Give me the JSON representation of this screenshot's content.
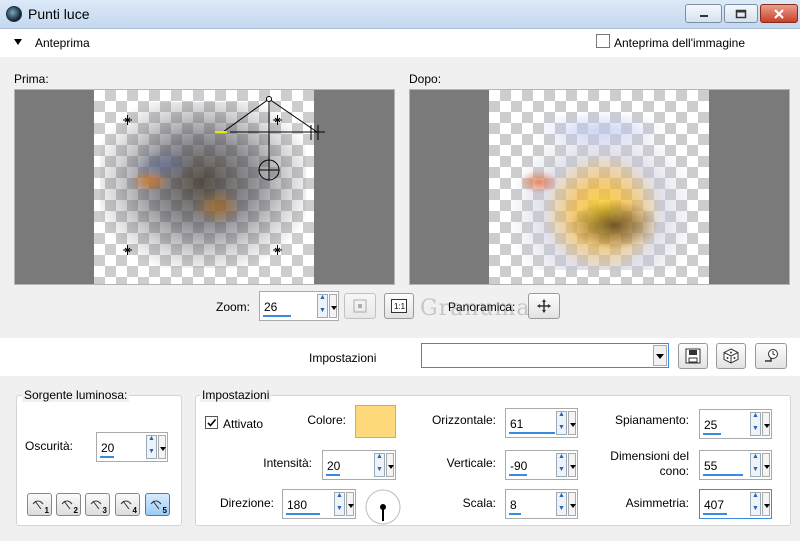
{
  "window": {
    "title": "Punti luce"
  },
  "preview_section": {
    "header_label": "Anteprima",
    "show_image_preview_label": "Anteprima dell'immagine",
    "show_image_preview_checked": false,
    "before_label": "Prima:",
    "after_label": "Dopo:",
    "zoom_label": "Zoom:",
    "zoom_value": "26",
    "pan_label": "Panoramica:"
  },
  "watermark": {
    "text": "Granuma"
  },
  "presets_bar": {
    "label": "Impostazioni",
    "value": ""
  },
  "light_source": {
    "title": "Sorgente luminosa:",
    "darkness_label": "Oscurità:",
    "darkness_value": "20",
    "presets": [
      "1",
      "2",
      "3",
      "4",
      "5"
    ],
    "selected_preset": "5"
  },
  "settings": {
    "title": "Impostazioni",
    "enabled_label": "Attivato",
    "enabled_checked": true,
    "color_label": "Colore:",
    "color_value": "#fdd97c",
    "intensity_label": "Intensità:",
    "intensity_value": "20",
    "direction_label": "Direzione:",
    "direction_value": "180",
    "horizontal_label": "Orizzontale:",
    "horizontal_value": "61",
    "vertical_label": "Verticale:",
    "vertical_value": "-90",
    "scale_label": "Scala:",
    "scale_value": "8",
    "flattening_label": "Spianamento:",
    "flattening_value": "25",
    "cone_size_label_1": "Dimensioni del",
    "cone_size_label_2": "cono:",
    "cone_size_value": "55",
    "asymmetry_label": "Asimmetria:",
    "asymmetry_value": "407"
  },
  "icons": [
    "eye-icon",
    "close-icon",
    "minimize-icon",
    "maximize-icon",
    "save-icon",
    "dice-icon",
    "reset-icon",
    "pan-icon",
    "zoom-fit-icon",
    "zoom-1to1-icon",
    "light-preset-icon"
  ]
}
